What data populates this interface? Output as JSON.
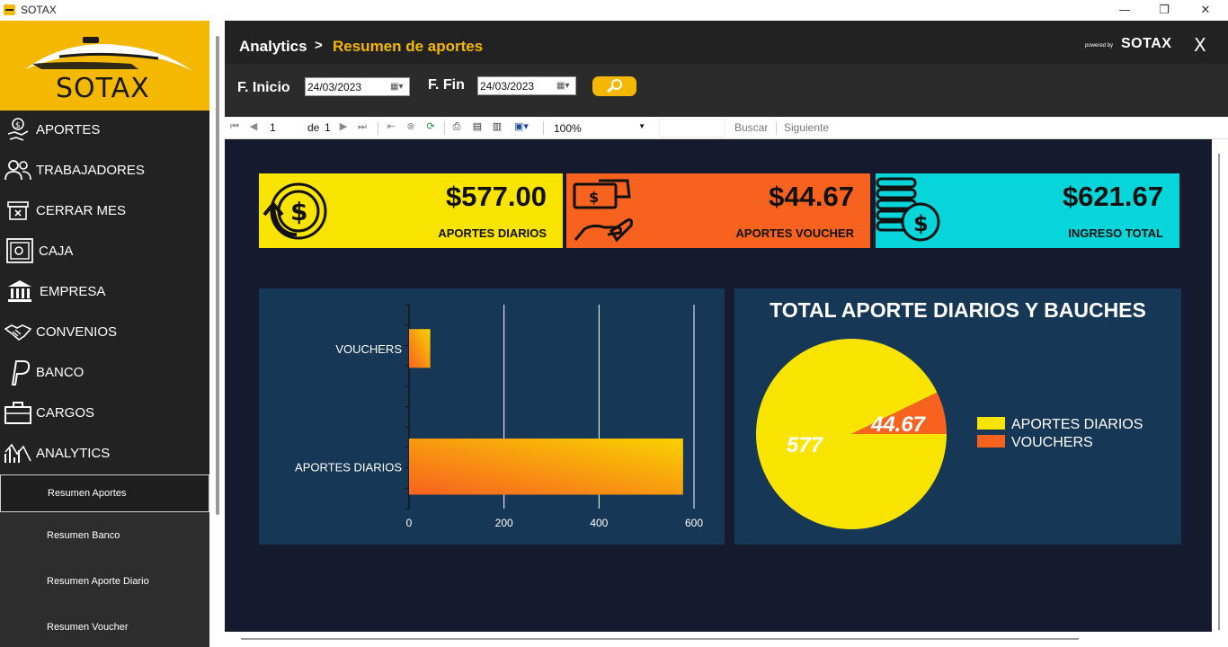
{
  "window": {
    "title": "SOTAX",
    "minimize": "—",
    "maximize": "❐",
    "close": "✕"
  },
  "brand": {
    "logo_text": "SOTAX",
    "powered_by": "powered by",
    "powered_brand": "SOTAX"
  },
  "sidebar": {
    "items": [
      {
        "label": "APORTES",
        "icon": "hand-coin-icon"
      },
      {
        "label": "TRABAJADORES",
        "icon": "users-icon"
      },
      {
        "label": "CERRAR MES",
        "icon": "archive-box-icon"
      },
      {
        "label": "CAJA",
        "icon": "safe-icon"
      },
      {
        "label": "EMPRESA",
        "icon": "bank-icon"
      },
      {
        "label": "CONVENIOS",
        "icon": "handshake-icon"
      },
      {
        "label": "BANCO",
        "icon": "paypal-icon"
      },
      {
        "label": "CARGOS",
        "icon": "briefcase-icon"
      },
      {
        "label": "ANALYTICS",
        "icon": "analytics-icon"
      }
    ],
    "subitems": [
      {
        "label": "Resumen Aportes",
        "active": true
      },
      {
        "label": "Resumen Banco",
        "active": false
      },
      {
        "label": "Resumen Aporte Diario",
        "active": false
      },
      {
        "label": "Resumen Voucher",
        "active": false
      }
    ]
  },
  "header": {
    "breadcrumb_root": "Analytics",
    "separator": ">",
    "current": "Resumen de aportes",
    "close": "X"
  },
  "filters": {
    "start_label": "F. Inicio",
    "start_value": "24/03/2023",
    "end_label": "F. Fin",
    "end_value": "24/03/2023"
  },
  "toolbar": {
    "page": "1",
    "of_label": "de",
    "total_pages": "1",
    "zoom": "100%",
    "find_label": "Buscar",
    "next_label": "Siguiente"
  },
  "kpis": [
    {
      "value": "$577.00",
      "label": "APORTES DIARIOS",
      "color": "#f9e400",
      "icon": "coin-arrow-icon"
    },
    {
      "value": "$44.67",
      "label": "APORTES VOUCHER",
      "color": "#f7621f",
      "icon": "money-hand-icon"
    },
    {
      "value": "$621.67",
      "label": "INGRESO TOTAL",
      "color": "#06d6da",
      "icon": "coin-stack-icon"
    }
  ],
  "chart_data": [
    {
      "type": "bar",
      "orientation": "horizontal",
      "categories": [
        "VOUCHERS",
        "APORTES DIARIOS"
      ],
      "values": [
        44.67,
        577
      ],
      "xlim": [
        0,
        600
      ],
      "xticks": [
        0,
        200,
        400,
        600
      ],
      "grid": true,
      "colors": [
        "#f7b400",
        "#f7621f"
      ]
    },
    {
      "type": "pie",
      "title": "TOTAL APORTE DIARIOS Y BAUCHES",
      "labels": [
        "APORTES DIARIOS",
        "VOUCHERS"
      ],
      "values": [
        577,
        44.67
      ],
      "data_labels": [
        "577",
        "44.67"
      ],
      "colors": [
        "#f9e400",
        "#f7621f"
      ],
      "legend": "right"
    }
  ]
}
